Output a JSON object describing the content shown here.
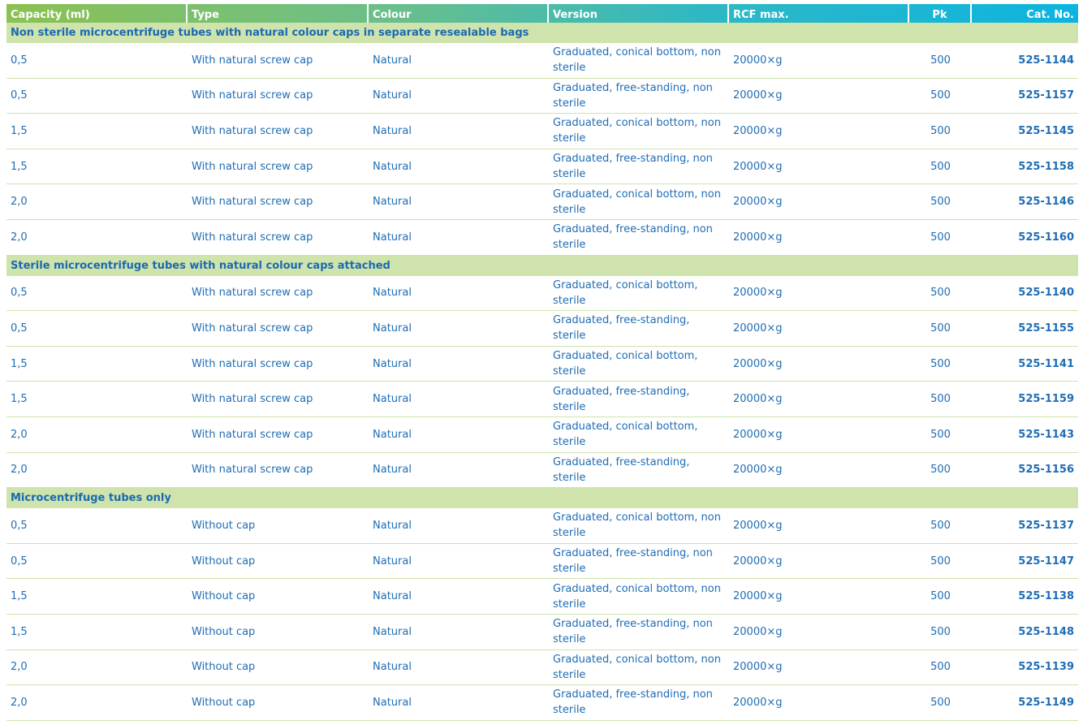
{
  "columns": [
    "Capacity (ml)",
    "Type",
    "Colour",
    "Version",
    "RCF max.",
    "Pk",
    "Cat. No."
  ],
  "groups": [
    {
      "title": "Non sterile microcentrifuge tubes with natural colour caps in separate resealable bags",
      "rows": [
        [
          "0,5",
          "With natural screw cap",
          "Natural",
          "Graduated, conical bottom, non sterile",
          "20000×g",
          "500",
          "525-1144"
        ],
        [
          "0,5",
          "With natural screw cap",
          "Natural",
          "Graduated, free-standing, non sterile",
          "20000×g",
          "500",
          "525-1157"
        ],
        [
          "1,5",
          "With natural screw cap",
          "Natural",
          "Graduated, conical bottom, non sterile",
          "20000×g",
          "500",
          "525-1145"
        ],
        [
          "1,5",
          "With natural screw cap",
          "Natural",
          "Graduated, free-standing, non sterile",
          "20000×g",
          "500",
          "525-1158"
        ],
        [
          "2,0",
          "With natural screw cap",
          "Natural",
          "Graduated, conical bottom, non sterile",
          "20000×g",
          "500",
          "525-1146"
        ],
        [
          "2,0",
          "With natural screw cap",
          "Natural",
          "Graduated, free-standing, non sterile",
          "20000×g",
          "500",
          "525-1160"
        ]
      ]
    },
    {
      "title": "Sterile microcentrifuge tubes with natural colour caps attached",
      "rows": [
        [
          "0,5",
          "With natural screw cap",
          "Natural",
          "Graduated, conical bottom, sterile",
          "20000×g",
          "500",
          "525-1140"
        ],
        [
          "0,5",
          "With natural screw cap",
          "Natural",
          "Graduated, free-standing, sterile",
          "20000×g",
          "500",
          "525-1155"
        ],
        [
          "1,5",
          "With natural screw cap",
          "Natural",
          "Graduated, conical bottom, sterile",
          "20000×g",
          "500",
          "525-1141"
        ],
        [
          "1,5",
          "With natural screw cap",
          "Natural",
          "Graduated, free-standing, sterile",
          "20000×g",
          "500",
          "525-1159"
        ],
        [
          "2,0",
          "With natural screw cap",
          "Natural",
          "Graduated, conical bottom, sterile",
          "20000×g",
          "500",
          "525-1143"
        ],
        [
          "2,0",
          "With natural screw cap",
          "Natural",
          "Graduated, free-standing, sterile",
          "20000×g",
          "500",
          "525-1156"
        ]
      ]
    },
    {
      "title": "Microcentrifuge tubes only",
      "rows": [
        [
          "0,5",
          "Without cap",
          "Natural",
          "Graduated, conical bottom, non sterile",
          "20000×g",
          "500",
          "525-1137"
        ],
        [
          "0,5",
          "Without cap",
          "Natural",
          "Graduated, free-standing, non sterile",
          "20000×g",
          "500",
          "525-1147"
        ],
        [
          "1,5",
          "Without cap",
          "Natural",
          "Graduated, conical bottom, non sterile",
          "20000×g",
          "500",
          "525-1138"
        ],
        [
          "1,5",
          "Without cap",
          "Natural",
          "Graduated, free-standing, non sterile",
          "20000×g",
          "500",
          "525-1148"
        ],
        [
          "2,0",
          "Without cap",
          "Natural",
          "Graduated, conical bottom, non sterile",
          "20000×g",
          "500",
          "525-1139"
        ],
        [
          "2,0",
          "Without cap",
          "Natural",
          "Graduated, free-standing, non sterile",
          "20000×g",
          "500",
          "525-1149"
        ]
      ]
    }
  ]
}
